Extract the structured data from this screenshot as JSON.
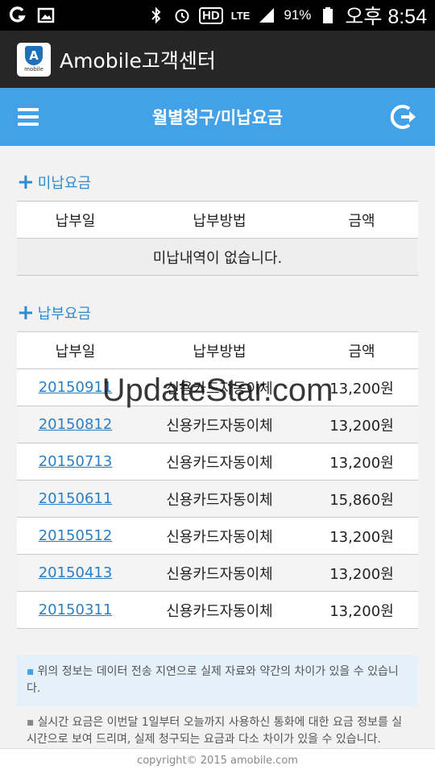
{
  "statusbar": {
    "battery": "91%",
    "clock": "오후 8:54",
    "hd": "HD",
    "lte": "LTE"
  },
  "app": {
    "title": "Amobile고객센터",
    "logo_letter": "A",
    "logo_sub": "mobile"
  },
  "nav": {
    "title": "월별청구/미납요금"
  },
  "unpaid": {
    "title": "미납요금",
    "headers": [
      "납부일",
      "납부방법",
      "금액"
    ],
    "empty_text": "미납내역이 없습니다."
  },
  "paid": {
    "title": "납부요금",
    "headers": [
      "납부일",
      "납부방법",
      "금액"
    ],
    "rows": [
      {
        "date": "20150911",
        "method": "신용카드자동이체",
        "amount": "13,200원"
      },
      {
        "date": "20150812",
        "method": "신용카드자동이체",
        "amount": "13,200원"
      },
      {
        "date": "20150713",
        "method": "신용카드자동이체",
        "amount": "13,200원"
      },
      {
        "date": "20150611",
        "method": "신용카드자동이체",
        "amount": "15,860원"
      },
      {
        "date": "20150512",
        "method": "신용카드자동이체",
        "amount": "13,200원"
      },
      {
        "date": "20150413",
        "method": "신용카드자동이체",
        "amount": "13,200원"
      },
      {
        "date": "20150311",
        "method": "신용카드자동이체",
        "amount": "13,200원"
      }
    ]
  },
  "notices": [
    "위의 정보는 데이터 전송 지연으로 실제 자료와 약간의 차이가 있을 수 있습니다.",
    "실시간 요금은 이번달 1일부터 오늘까지 사용하신 통화에 대한 요금 정보를 실시간으로 보여 드리며, 실제 청구되는 요금과 다소 차이가 있을 수 있습니다."
  ],
  "footer": "copyright© 2015 amobile.com",
  "watermark": "UpdateStar.com",
  "colors": {
    "accent": "#42a1e7",
    "link": "#2a7fc4",
    "appbar": "#262626"
  }
}
